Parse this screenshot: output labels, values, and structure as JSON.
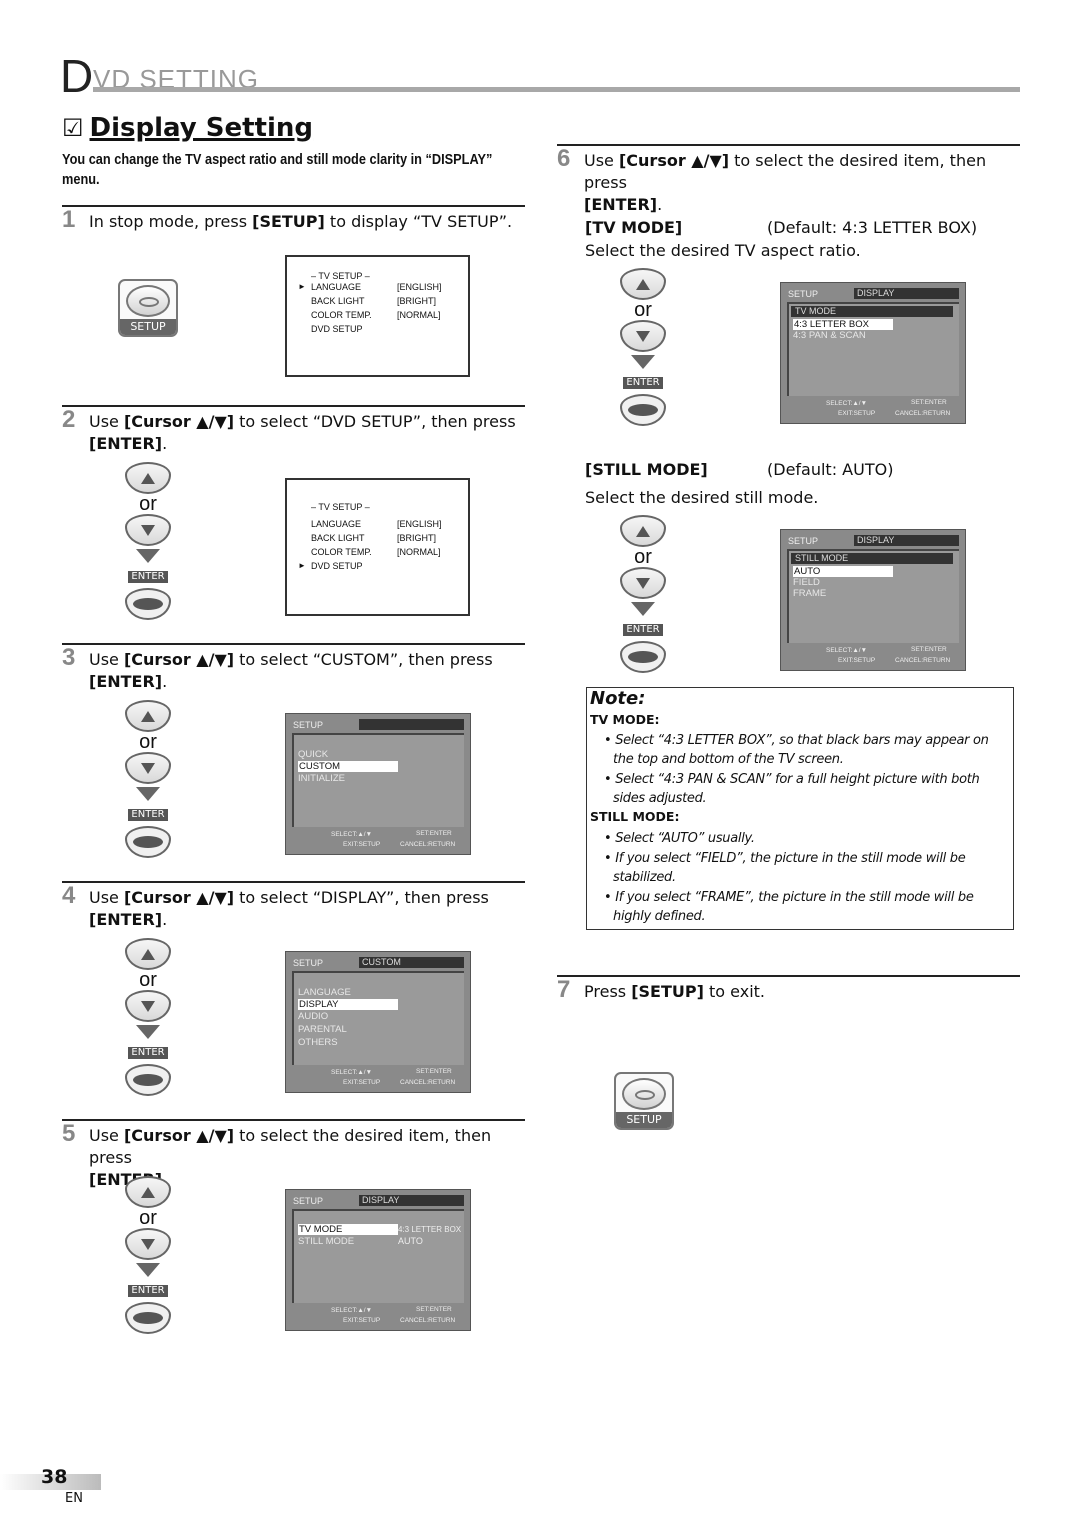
{
  "header": {
    "initial": "D",
    "rest": "VD  SETTING"
  },
  "section": {
    "checkbox_glyph": "☑",
    "title": "Display Setting",
    "intro": "You can change the TV aspect ratio and still mode clarity in “DISPLAY” menu."
  },
  "steps": [
    {
      "num": "1",
      "pre": "In stop mode, press ",
      "bold": "[SETUP]",
      "post": " to display “TV SETUP”."
    },
    {
      "num": "2",
      "pre": "Use ",
      "bold": "[Cursor ▲/▼]",
      "post": " to select “DVD SETUP”, then press",
      "line2": "[ENTER]",
      "line2_post": "."
    },
    {
      "num": "3",
      "pre": "Use ",
      "bold": "[Cursor ▲/▼]",
      "post": " to select “CUSTOM”, then press",
      "line2": "[ENTER]",
      "line2_post": "."
    },
    {
      "num": "4",
      "pre": "Use ",
      "bold": "[Cursor ▲/▼]",
      "post": " to select “DISPLAY”, then press",
      "line2": "[ENTER]",
      "line2_post": "."
    },
    {
      "num": "5",
      "pre": "Use ",
      "bold": "[Cursor ▲/▼]",
      "post": " to select the desired item, then press",
      "line2": "[ENTER]",
      "line2_post": "."
    },
    {
      "num": "6",
      "pre": "Use ",
      "bold": "[Cursor ▲/▼]",
      "post": " to select the desired item, then press",
      "line2": "[ENTER]",
      "line2_post": "."
    },
    {
      "num": "7",
      "pre": "Press ",
      "bold": "[SETUP]",
      "post": " to exit."
    }
  ],
  "remote": {
    "or": "or",
    "enter": "ENTER",
    "setup": "SETUP"
  },
  "tv_setup": {
    "title": "– TV SETUP –",
    "rows": [
      {
        "label": "LANGUAGE",
        "value": "[ENGLISH]"
      },
      {
        "label": "BACK LIGHT",
        "value": "[BRIGHT]"
      },
      {
        "label": "COLOR TEMP.",
        "value": "[NORMAL]"
      },
      {
        "label": "DVD SETUP",
        "value": ""
      }
    ],
    "cursor": "►"
  },
  "osd": {
    "setup": "SETUP",
    "footer": {
      "select": "SELECT:▲/▼",
      "set": "SET:ENTER",
      "exit": "EXIT:SETUP",
      "cancel": "CANCEL:RETURN"
    },
    "screen3": {
      "tab": "",
      "items": [
        "QUICK",
        "CUSTOM",
        "INITIALIZE"
      ],
      "selected": "CUSTOM"
    },
    "screen4": {
      "tab": "CUSTOM",
      "items": [
        "LANGUAGE",
        "DISPLAY",
        "AUDIO",
        "PARENTAL",
        "OTHERS"
      ],
      "selected": "DISPLAY"
    },
    "screen5": {
      "tab": "DISPLAY",
      "items": [
        {
          "label": "TV MODE",
          "value": "4:3 LETTER BOX"
        },
        {
          "label": "STILL MODE",
          "value": "AUTO"
        }
      ],
      "selected": "TV MODE"
    },
    "screen_tv": {
      "tab": "DISPLAY",
      "sub": "TV MODE",
      "items": [
        "4:3 LETTER BOX",
        "4:3 PAN & SCAN"
      ],
      "selected": "4:3 LETTER BOX"
    },
    "screen_still": {
      "tab": "DISPLAY",
      "sub": "STILL MODE",
      "items": [
        "AUTO",
        "FIELD",
        "FRAME"
      ],
      "selected": "AUTO"
    }
  },
  "tv_mode": {
    "label": "[TV MODE]",
    "default": "(Default: 4:3 LETTER BOX)",
    "desc": "Select the desired TV aspect ratio."
  },
  "still_mode": {
    "label": "[STILL MODE]",
    "default": "(Default: AUTO)",
    "desc": "Select the desired still mode."
  },
  "note": {
    "title": "Note:",
    "tv_heading": "TV MODE:",
    "tv_bullets": [
      "• Select “4:3 LETTER BOX”, so that black bars may appear on the top and bottom of the TV screen.",
      "• Select “4:3 PAN & SCAN” for a full height picture with both sides adjusted."
    ],
    "still_heading": "STILL MODE:",
    "still_bullets": [
      "• Select “AUTO” usually.",
      "• If you select “FIELD”, the picture in the still mode will be stabilized.",
      "• If you select “FRAME”, the picture in the still mode will be highly defined."
    ]
  },
  "footer": {
    "page": "38",
    "lang": "EN"
  }
}
